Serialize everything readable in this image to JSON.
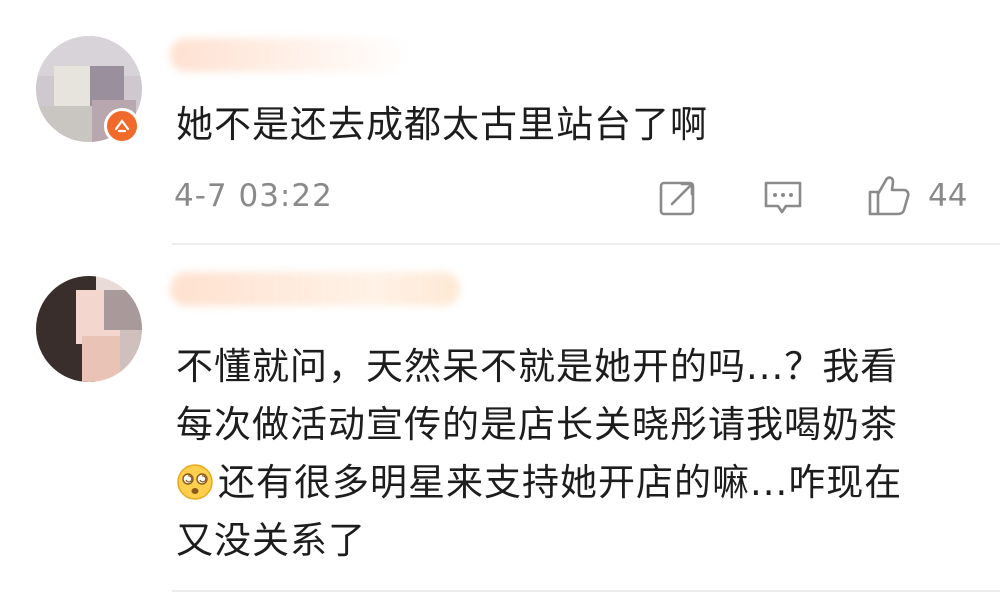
{
  "comments": [
    {
      "text": "她不是还去成都太古里站台了啊",
      "time": "4-7 03:22",
      "likes": "44",
      "icons": {
        "share": "share-icon",
        "reply": "comment-icon",
        "like": "thumbs-up-icon"
      }
    },
    {
      "lines": [
        "不懂就问，天然呆不就是她开的吗...？我看",
        "每次做活动宣传的是店长关晓彤请我喝奶茶",
        "还有很多明星来支持她开店的嘛...咋现在",
        "又没关系了"
      ],
      "emoji": "dizzy-face-emoji"
    }
  ],
  "colors": {
    "text": "#1d1d1d",
    "meta": "#8a8a8a",
    "divider": "#ececec",
    "badge": "#f26a2b"
  }
}
